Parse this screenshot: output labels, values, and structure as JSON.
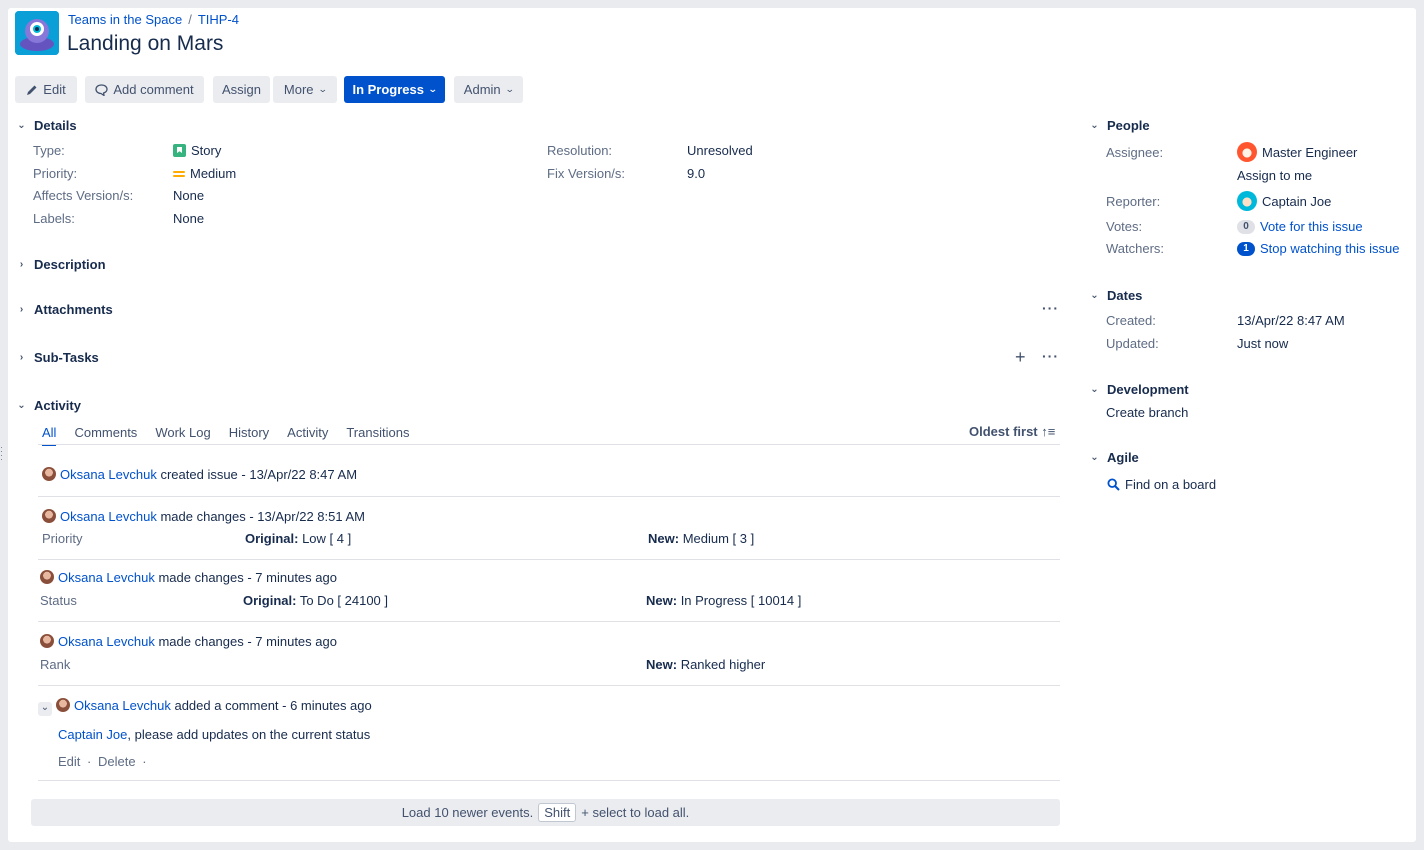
{
  "header": {
    "breadcrumb": [
      "Teams in the Space",
      "TIHP-4"
    ],
    "breadcrumb_sep": "/",
    "title": "Landing on Mars"
  },
  "toolbar": {
    "edit": "Edit",
    "add_comment": "Add comment",
    "assign": "Assign",
    "more": "More",
    "status": "In Progress",
    "admin": "Admin"
  },
  "details": {
    "heading": "Details",
    "type_label": "Type:",
    "type_value": "Story",
    "priority_label": "Priority:",
    "priority_value": "Medium",
    "affects_label": "Affects Version/s:",
    "affects_value": "None",
    "labels_label": "Labels:",
    "labels_value": "None",
    "resolution_label": "Resolution:",
    "resolution_value": "Unresolved",
    "fix_label": "Fix Version/s:",
    "fix_value": "9.0"
  },
  "sections": {
    "description": "Description",
    "attachments": "Attachments",
    "subtasks": "Sub-Tasks",
    "activity": "Activity"
  },
  "activity": {
    "tabs": [
      "All",
      "Comments",
      "Work Log",
      "History",
      "Activity",
      "Transitions"
    ],
    "sort": "Oldest first ↑≡",
    "entries": [
      {
        "user": "Oksana Levchuk",
        "action": "created issue - 13/Apr/22 8:47 AM"
      },
      {
        "user": "Oksana Levchuk",
        "action": "made changes - 13/Apr/22 8:51 AM",
        "field": "Priority",
        "original_label": "Original:",
        "original": "Low [ 4 ]",
        "new_label": "New:",
        "new": "Medium [ 3 ]"
      },
      {
        "user": "Oksana Levchuk",
        "action": "made changes - 7 minutes ago",
        "field": "Status",
        "original_label": "Original:",
        "original": "To Do [ 24100 ]",
        "new_label": "New:",
        "new": "In Progress [ 10014 ]"
      },
      {
        "user": "Oksana Levchuk",
        "action": "made changes - 7 minutes ago",
        "field": "Rank",
        "new_label": "New:",
        "new": "Ranked higher"
      },
      {
        "user": "Oksana Levchuk",
        "action": "added a comment - 6 minutes ago",
        "mention": "Captain Joe",
        "comment": ", please add updates on the current status",
        "edit": "Edit",
        "delete": "Delete",
        "dot": "·"
      }
    ],
    "load_more_pre": "Load 10 newer events.",
    "load_more_key": "Shift",
    "load_more_post": "+ select to load all."
  },
  "people": {
    "heading": "People",
    "assignee_label": "Assignee:",
    "assignee": "Master Engineer",
    "assign_to_me": "Assign to me",
    "reporter_label": "Reporter:",
    "reporter": "Captain Joe",
    "votes_label": "Votes:",
    "votes_count": "0",
    "vote_link": "Vote for this issue",
    "watchers_label": "Watchers:",
    "watchers_count": "1",
    "watch_link": "Stop watching this issue"
  },
  "dates": {
    "heading": "Dates",
    "created_label": "Created:",
    "created": "13/Apr/22 8:47 AM",
    "updated_label": "Updated:",
    "updated": "Just now"
  },
  "development": {
    "heading": "Development",
    "create_branch": "Create branch"
  },
  "agile": {
    "heading": "Agile",
    "find_board": "Find on a board"
  }
}
